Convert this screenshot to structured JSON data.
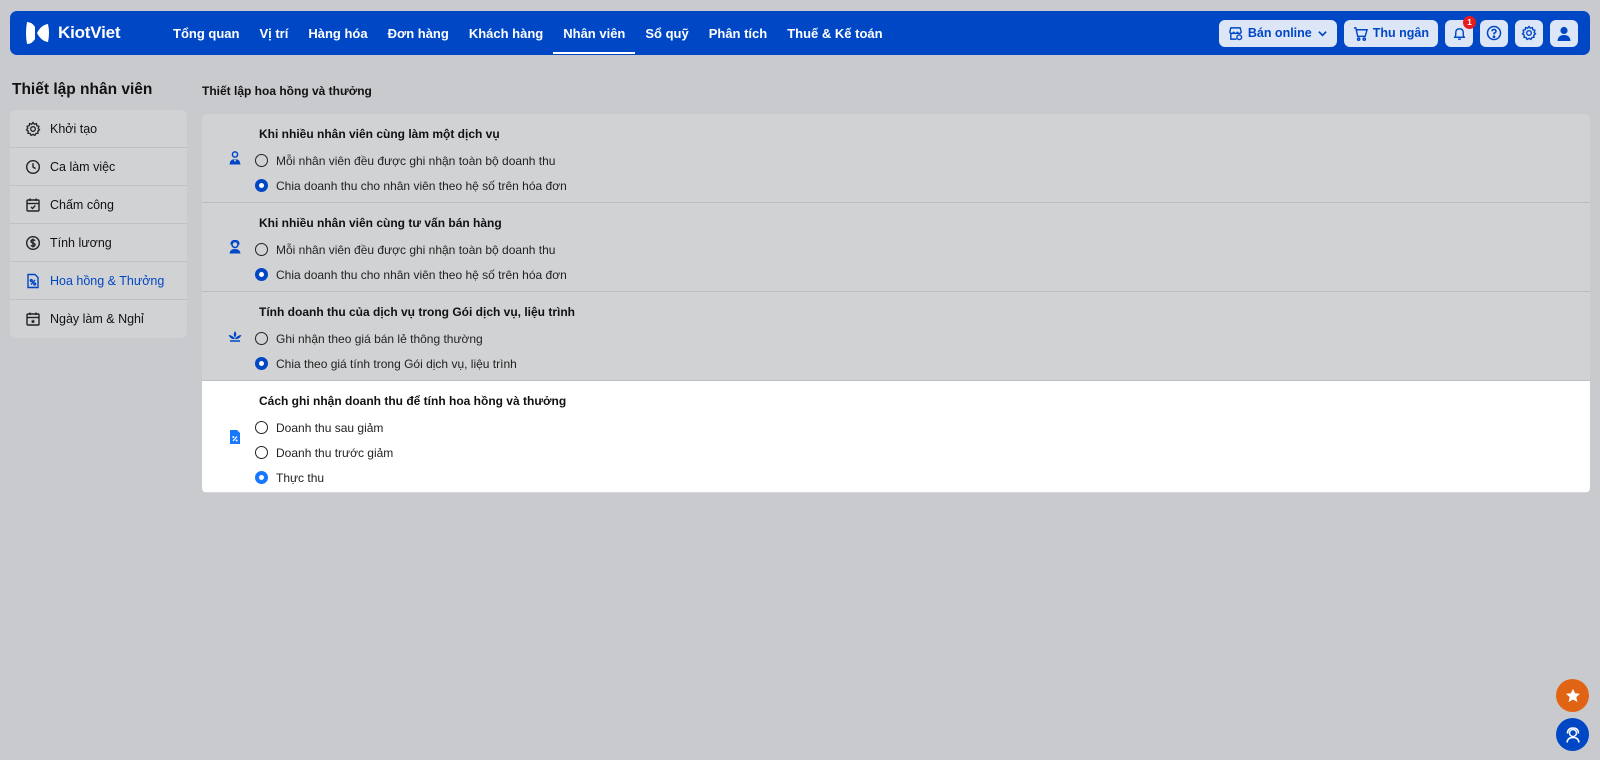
{
  "brand": {
    "name": "KiotViet"
  },
  "nav": {
    "items": [
      {
        "label": "Tổng quan"
      },
      {
        "label": "Vị trí"
      },
      {
        "label": "Hàng hóa"
      },
      {
        "label": "Đơn hàng"
      },
      {
        "label": "Khách hàng"
      },
      {
        "label": "Nhân viên",
        "active": true
      },
      {
        "label": "Sổ quỹ"
      },
      {
        "label": "Phân tích"
      },
      {
        "label": "Thuế & Kế toán"
      }
    ]
  },
  "top_actions": {
    "online_label": "Bán online",
    "cashier_label": "Thu ngân",
    "notification_count": "1"
  },
  "sidebar": {
    "title": "Thiết lập nhân viên",
    "items": [
      {
        "label": "Khởi tạo",
        "icon": "gear-icon"
      },
      {
        "label": "Ca làm việc",
        "icon": "clock-icon"
      },
      {
        "label": "Chấm công",
        "icon": "calendar-check-icon"
      },
      {
        "label": "Tính lương",
        "icon": "dollar-icon"
      },
      {
        "label": "Hoa hồng & Thưởng",
        "icon": "percent-doc-icon",
        "active": true
      },
      {
        "label": "Ngày làm & Nghỉ",
        "icon": "calendar-star-icon"
      }
    ]
  },
  "main": {
    "title": "Thiết lập hoa hồng và thưởng",
    "sections": [
      {
        "title": "Khi nhiều nhân viên cùng làm một dịch vụ",
        "icon": "service-staff-icon",
        "options": [
          {
            "label": "Mỗi nhân viên đều được ghi nhận toàn bộ doanh thu",
            "selected": false
          },
          {
            "label": "Chia doanh thu cho nhân viên theo hệ số trên hóa đơn",
            "selected": true
          }
        ]
      },
      {
        "title": "Khi nhiều nhân viên cùng tư vấn bán hàng",
        "icon": "consultant-icon",
        "options": [
          {
            "label": "Mỗi nhân viên đều được ghi nhận toàn bộ doanh thu",
            "selected": false
          },
          {
            "label": "Chia doanh thu cho nhân viên theo hệ số trên hóa đơn",
            "selected": true
          }
        ]
      },
      {
        "title": "Tính doanh thu của dịch vụ trong Gói dịch vụ, liệu trình",
        "icon": "lotus-icon",
        "options": [
          {
            "label": "Ghi nhận theo giá bán lẻ thông thường",
            "selected": false
          },
          {
            "label": "Chia theo giá tính trong Gói dịch vụ, liệu trình",
            "selected": true
          }
        ]
      },
      {
        "title": "Cách ghi nhận doanh thu để tính hoa hồng và thưởng",
        "icon": "percent-doc-icon",
        "options": [
          {
            "label": "Doanh thu sau giảm",
            "selected": false
          },
          {
            "label": "Doanh thu trước giảm",
            "selected": false
          },
          {
            "label": "Thực thu",
            "selected": true
          }
        ]
      }
    ]
  },
  "colors": {
    "brand_blue": "#0047c6",
    "active_radio": "#1677ff",
    "star_fab": "#e06414",
    "notification_badge": "#e61b1b"
  }
}
